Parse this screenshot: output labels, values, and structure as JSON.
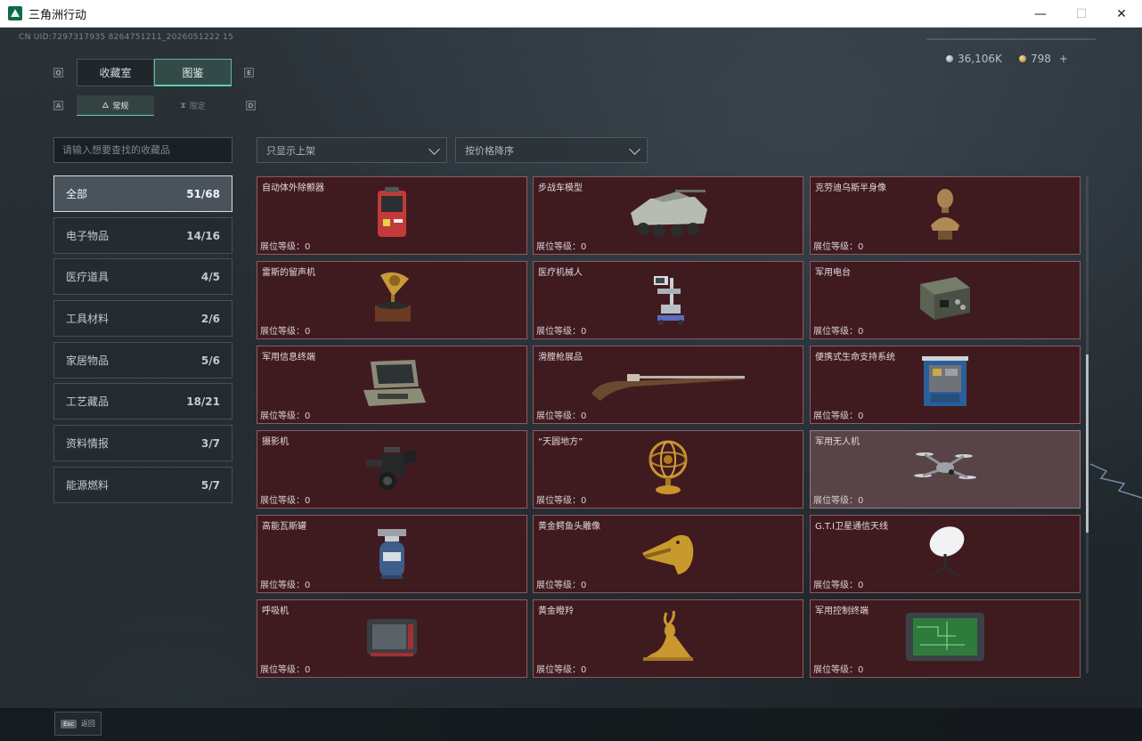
{
  "window": {
    "title": "三角洲行动",
    "minimize": "—",
    "maximize": "☐",
    "close": "✕"
  },
  "uid": "CN UID:7297317935 8264751211_2026051222 15",
  "currency": [
    {
      "value": "36,106K",
      "icon": "silver-coin-icon"
    },
    {
      "value": "798",
      "add": "+",
      "icon": "gold-coin-icon"
    }
  ],
  "keyhints": {
    "tab_prev": "Q",
    "tab_next": "E",
    "sub_prev": "A",
    "sub_next": "D"
  },
  "tabs": [
    {
      "label": "收藏室",
      "active": false
    },
    {
      "label": "图鉴",
      "active": true
    }
  ],
  "subtabs": [
    {
      "label": "常规",
      "icon": "flame-icon",
      "active": true
    },
    {
      "label": "限定",
      "icon": "hourglass-icon",
      "active": false
    }
  ],
  "search": {
    "placeholder": "请输入想要查找的收藏品"
  },
  "filters": [
    {
      "label": "只显示上架"
    },
    {
      "label": "按价格降序"
    }
  ],
  "categories": [
    {
      "label": "全部",
      "count": "51/68",
      "active": true
    },
    {
      "label": "电子物品",
      "count": "14/16"
    },
    {
      "label": "医疗道具",
      "count": "4/5"
    },
    {
      "label": "工具材料",
      "count": "2/6"
    },
    {
      "label": "家居物品",
      "count": "5/6"
    },
    {
      "label": "工艺藏品",
      "count": "18/21"
    },
    {
      "label": "资料情报",
      "count": "3/7"
    },
    {
      "label": "能源燃料",
      "count": "5/7"
    }
  ],
  "level_label": "展位等级：0",
  "items": [
    {
      "name": "自动体外除颤器",
      "icon": "defibrillator-icon"
    },
    {
      "name": "步战车模型",
      "icon": "ifv-model-icon"
    },
    {
      "name": "克劳迪乌斯半身像",
      "icon": "bust-icon"
    },
    {
      "name": "雷斯的留声机",
      "icon": "gramophone-icon"
    },
    {
      "name": "医疗机械人",
      "icon": "medical-robot-icon"
    },
    {
      "name": "军用电台",
      "icon": "military-radio-icon"
    },
    {
      "name": "军用信息终端",
      "icon": "info-terminal-icon"
    },
    {
      "name": "滑膛枪展品",
      "icon": "musket-icon"
    },
    {
      "name": "便携式生命支持系统",
      "icon": "life-support-icon"
    },
    {
      "name": "摄影机",
      "icon": "camera-icon"
    },
    {
      "name": "“天圆地方”",
      "icon": "armillary-sphere-icon"
    },
    {
      "name": "军用无人机",
      "icon": "drone-icon",
      "hover": true
    },
    {
      "name": "高能瓦斯罐",
      "icon": "gas-canister-icon"
    },
    {
      "name": "黄金鳄鱼头雕像",
      "icon": "gold-crocodile-icon"
    },
    {
      "name": "G.T.I卫星通信天线",
      "icon": "satellite-dish-icon"
    },
    {
      "name": "呼吸机",
      "icon": "ventilator-icon"
    },
    {
      "name": "黄金瞪羚",
      "icon": "gold-gazelle-icon"
    },
    {
      "name": "军用控制终端",
      "icon": "control-terminal-icon"
    }
  ],
  "footer": {
    "esc_key": "Esc",
    "back_label": "返回"
  },
  "colors": {
    "accent": "#5fcfa8",
    "card_bg": "#3f1b20",
    "card_border": "#8e5a63",
    "card_hover": "#584346"
  }
}
